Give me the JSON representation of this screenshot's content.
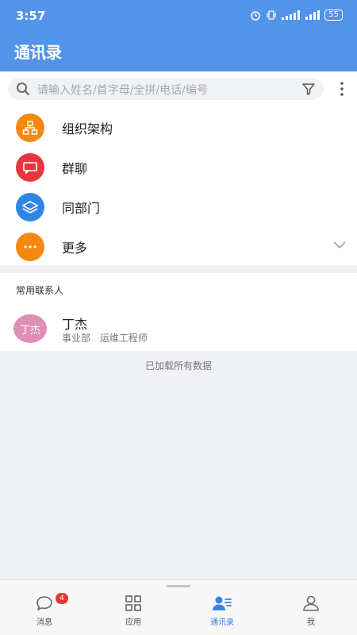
{
  "status_bar": {
    "time": "3:57",
    "battery": "55"
  },
  "header": {
    "title": "通讯录"
  },
  "search": {
    "placeholder": "请输入姓名/首字母/全拼/电话/编号"
  },
  "menu": [
    {
      "label": "组织架构",
      "icon": "org-chart-icon",
      "color": "#f5880e"
    },
    {
      "label": "群聊",
      "icon": "chat-icon",
      "color": "#e8363f"
    },
    {
      "label": "同部门",
      "icon": "layers-icon",
      "color": "#2f86e4"
    },
    {
      "label": "更多",
      "icon": "more-dots-icon",
      "color": "#f5880e"
    }
  ],
  "contacts": {
    "section_title": "常用联系人",
    "items": [
      {
        "avatar_text": "丁杰",
        "name": "丁杰",
        "department": "事业部",
        "title": "运维工程师",
        "avatar_color": "#dd8fb7"
      }
    ]
  },
  "footer_note": "已加载所有数据",
  "tabbar": {
    "tabs": [
      {
        "label": "消息",
        "icon": "message-icon",
        "badge": "4"
      },
      {
        "label": "应用",
        "icon": "apps-grid-icon"
      },
      {
        "label": "通讯录",
        "icon": "contacts-icon",
        "active": true
      },
      {
        "label": "我",
        "icon": "profile-icon"
      }
    ],
    "active_color": "#3b82e7"
  },
  "colors": {
    "primary": "#5393e8"
  }
}
